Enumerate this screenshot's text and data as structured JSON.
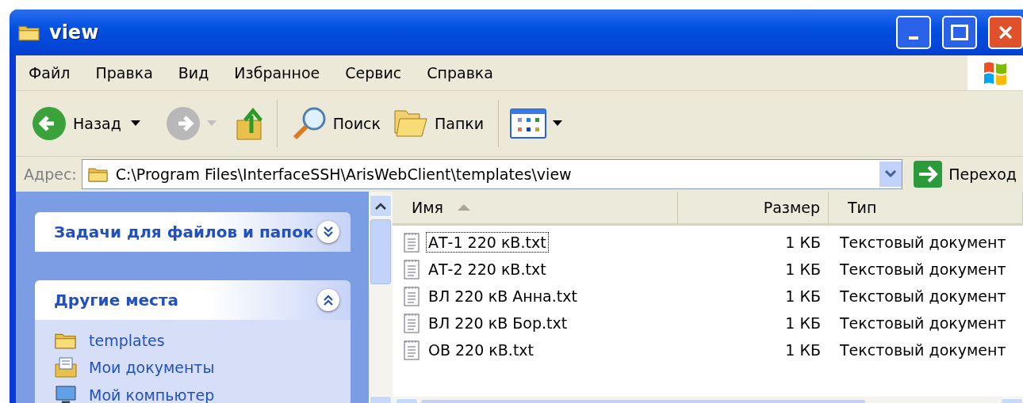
{
  "window": {
    "title": "view"
  },
  "menu": [
    "Файл",
    "Правка",
    "Вид",
    "Избранное",
    "Сервис",
    "Справка"
  ],
  "toolbar": {
    "back": "Назад",
    "search": "Поиск",
    "folders": "Папки"
  },
  "address": {
    "label": "Адрес:",
    "value": "C:\\Program Files\\InterfaceSSH\\ArisWebClient\\templates\\view",
    "go": "Переход"
  },
  "task_panels": [
    {
      "title": "Задачи для файлов и папок",
      "expanded": false
    },
    {
      "title": "Другие места",
      "expanded": true,
      "items": [
        {
          "label": "templates",
          "kind": "folder"
        },
        {
          "label": "Мои документы",
          "kind": "documents"
        },
        {
          "label": "Мой компьютер",
          "kind": "computer"
        }
      ]
    }
  ],
  "table": {
    "columns": [
      {
        "label": "Имя",
        "sorted": true
      },
      {
        "label": "Размер",
        "sorted": false
      },
      {
        "label": "Тип",
        "sorted": false
      }
    ],
    "rows": [
      {
        "name": "АТ-1 220 кВ.txt",
        "size": "1 КБ",
        "type": "Текстовый документ",
        "focused": true
      },
      {
        "name": "АТ-2 220 кВ.txt",
        "size": "1 КБ",
        "type": "Текстовый документ",
        "focused": false
      },
      {
        "name": "ВЛ 220 кВ Анна.txt",
        "size": "1 КБ",
        "type": "Текстовый документ",
        "focused": false
      },
      {
        "name": "ВЛ 220 кВ Бор.txt",
        "size": "1 КБ",
        "type": "Текстовый документ",
        "focused": false
      },
      {
        "name": "ОВ 220 кВ.txt",
        "size": "1 КБ",
        "type": "Текстовый документ",
        "focused": false
      }
    ]
  }
}
